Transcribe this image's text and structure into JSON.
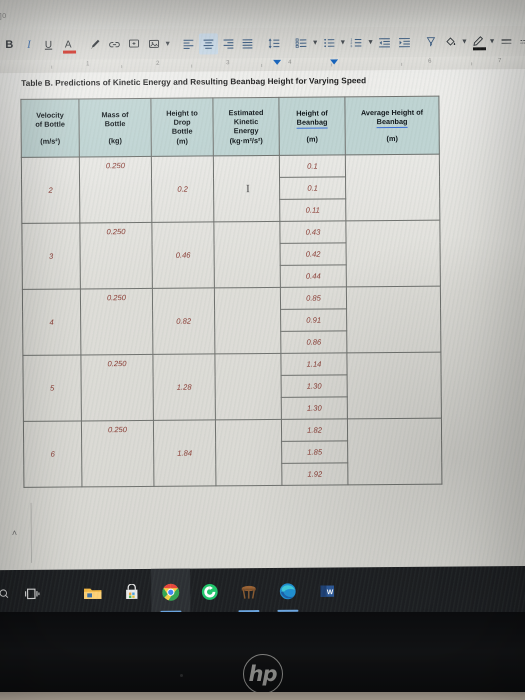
{
  "window": {
    "ghost_label": "]0",
    "app": "Google Docs"
  },
  "toolbar": {
    "items": [
      {
        "name": "bold-button",
        "label": "B"
      },
      {
        "name": "italic-button",
        "label": "I"
      },
      {
        "name": "underline-button",
        "label": "U"
      },
      {
        "name": "text-color-button",
        "label": "A",
        "color": "#d93025"
      },
      {
        "name": "paint-format-button",
        "label": "brush-icon"
      },
      {
        "name": "insert-link-button",
        "label": "link-icon"
      },
      {
        "name": "add-comment-button",
        "label": "comment-icon"
      },
      {
        "name": "insert-image-button",
        "label": "image-icon"
      },
      {
        "name": "align-left-button",
        "label": "align-left-icon"
      },
      {
        "name": "align-center-button",
        "label": "align-center-icon"
      },
      {
        "name": "align-right-button",
        "label": "align-right-icon"
      },
      {
        "name": "align-justify-button",
        "label": "align-justify-icon"
      },
      {
        "name": "line-spacing-button",
        "label": "line-spacing-icon"
      },
      {
        "name": "checklist-button",
        "label": "checklist-icon"
      },
      {
        "name": "bulleted-list-button",
        "label": "bulleted-list-icon"
      },
      {
        "name": "numbered-list-button",
        "label": "numbered-list-icon"
      },
      {
        "name": "decrease-indent-button",
        "label": "decrease-indent-icon"
      },
      {
        "name": "increase-indent-button",
        "label": "increase-indent-icon"
      },
      {
        "name": "clear-formatting-button",
        "label": "clear-formatting-icon"
      },
      {
        "name": "fill-color-button",
        "label": "paint-bucket-icon"
      },
      {
        "name": "border-color-button",
        "label": "pencil-icon"
      },
      {
        "name": "border-width-button",
        "label": "border-width-icon"
      },
      {
        "name": "border-dash-button",
        "label": "border-dash-icon"
      }
    ]
  },
  "ruler": {
    "numbers": [
      "1",
      "2",
      "3",
      "4",
      "6",
      "7"
    ]
  },
  "document": {
    "title": "Table B. Predictions of Kinetic Energy and Resulting Beanbag Height for Varying Speed",
    "collapse_chevron": "˄"
  },
  "table": {
    "headers": [
      {
        "line1": "Velocity",
        "line2": "of Bottle",
        "unit": "(m/s²)",
        "misspelled": false
      },
      {
        "line1": "Mass of",
        "line2": "Bottle",
        "unit": "(kg)",
        "misspelled": false
      },
      {
        "line1": "Height to",
        "line2": "Drop",
        "line3": "Bottle",
        "unit": "(m)",
        "misspelled": false
      },
      {
        "line1": "Estimated",
        "line2": "Kinetic",
        "line3": "Energy",
        "unit": "(kg·m²/s²)",
        "misspelled": false
      },
      {
        "line1": "Height of",
        "line2": "Beanbag",
        "unit": "(m)",
        "misspelled": true
      },
      {
        "line1": "Average Height of",
        "line2": "Beanbag",
        "unit": "(m)",
        "misspelled": true
      }
    ],
    "rows": [
      {
        "velocity": "2",
        "mass": "0.250",
        "drop_height": "0.2",
        "kinetic_energy": "",
        "kinetic_energy_has_cursor": true,
        "beanbag_heights": [
          "0.1",
          "0.1",
          "0.11"
        ],
        "average_height": ""
      },
      {
        "velocity": "3",
        "mass": "0.250",
        "drop_height": "0.46",
        "kinetic_energy": "",
        "kinetic_energy_has_cursor": false,
        "beanbag_heights": [
          "0.43",
          "0.42",
          "0.44"
        ],
        "average_height": ""
      },
      {
        "velocity": "4",
        "mass": "0.250",
        "drop_height": "0.82",
        "kinetic_energy": "",
        "kinetic_energy_has_cursor": false,
        "beanbag_heights": [
          "0.85",
          "0.91",
          "0.86"
        ],
        "average_height": ""
      },
      {
        "velocity": "5",
        "mass": "0.250",
        "drop_height": "1.28",
        "kinetic_energy": "",
        "kinetic_energy_has_cursor": false,
        "beanbag_heights": [
          "1.14",
          "1.30",
          "1.30"
        ],
        "average_height": ""
      },
      {
        "velocity": "6",
        "mass": "0.250",
        "drop_height": "1.84",
        "kinetic_energy": "",
        "kinetic_energy_has_cursor": false,
        "beanbag_heights": [
          "1.82",
          "1.85",
          "1.92"
        ],
        "average_height": ""
      }
    ],
    "colors": {
      "header_fill": "#bfd4d3",
      "value_text": "#8a3b33",
      "velocity_text": "#2b2b2b",
      "border": "#6f716e",
      "spellcheck_underline": "#3a6fd8"
    }
  },
  "taskbar": {
    "items": [
      {
        "name": "taskbar-search-icon",
        "label": "search"
      },
      {
        "name": "taskbar-task-view-icon",
        "label": "task-view"
      },
      {
        "name": "taskbar-file-explorer-icon",
        "label": "file-explorer"
      },
      {
        "name": "taskbar-microsoft-store-icon",
        "label": "microsoft-store"
      },
      {
        "name": "taskbar-chrome-icon",
        "label": "google-chrome"
      },
      {
        "name": "taskbar-green-app-icon",
        "label": "green-app"
      },
      {
        "name": "taskbar-stool-app-icon",
        "label": "stool-app"
      },
      {
        "name": "taskbar-edge-icon",
        "label": "microsoft-edge"
      },
      {
        "name": "taskbar-word-icon",
        "label": "microsoft-word"
      }
    ]
  },
  "device": {
    "brand": "hp"
  }
}
